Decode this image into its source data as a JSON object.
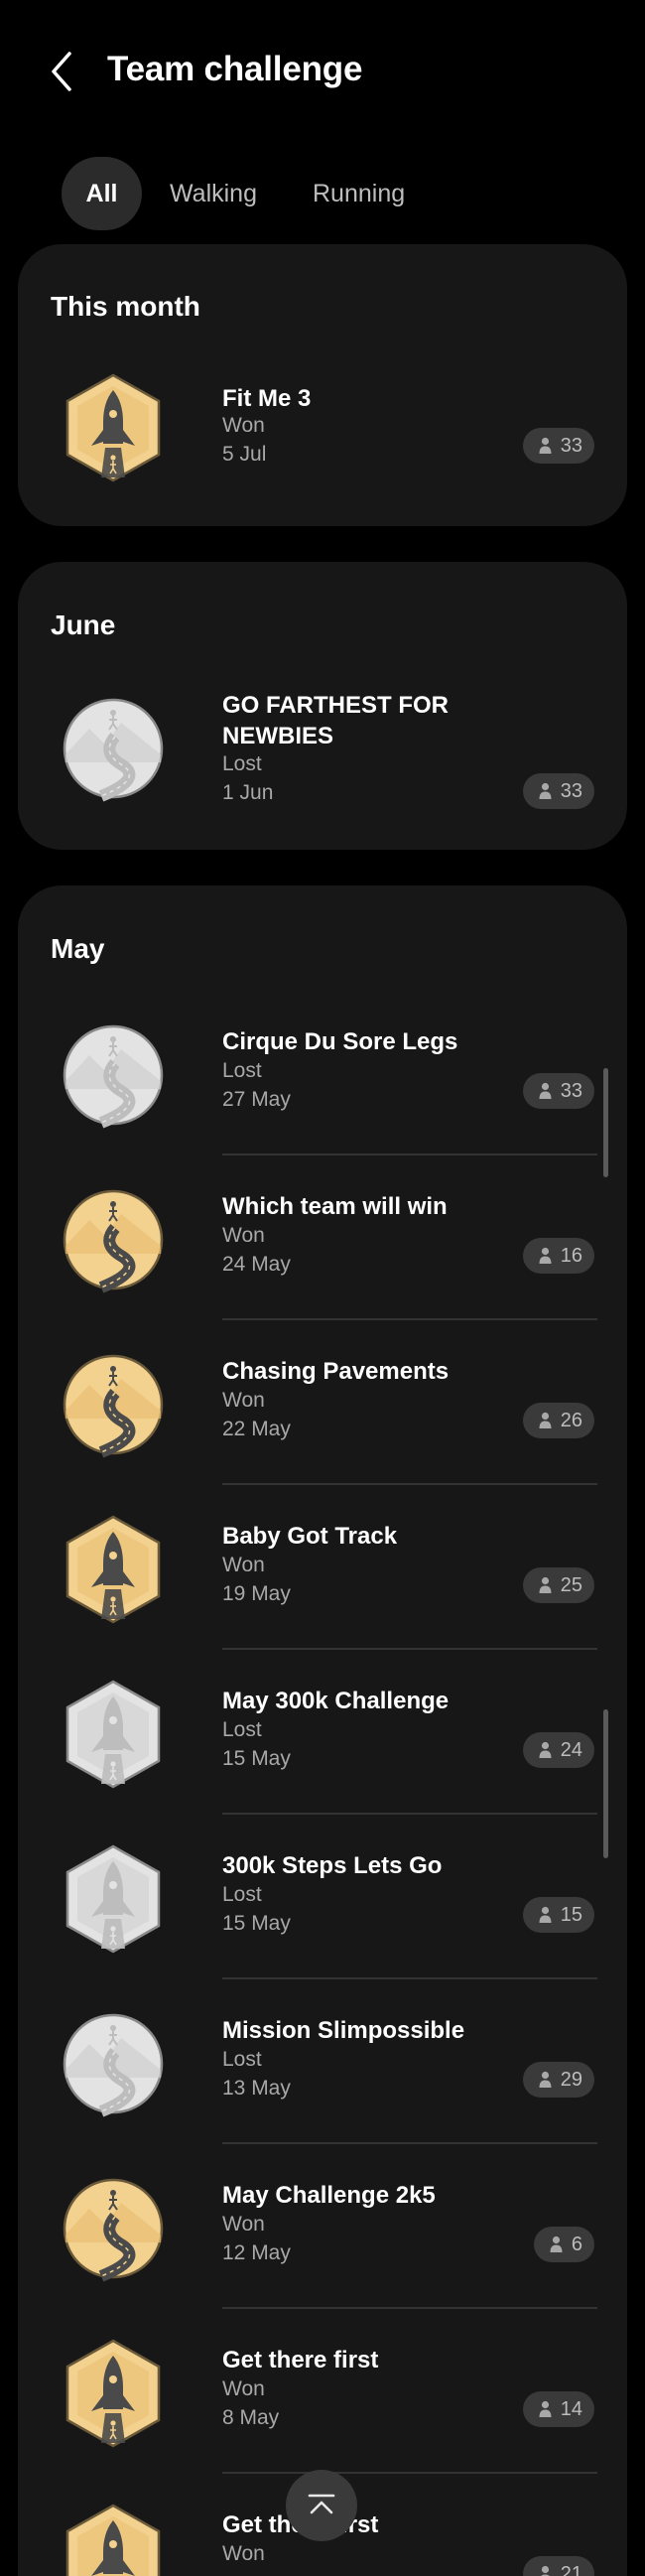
{
  "header": {
    "title": "Team challenge",
    "back_icon": "chevron-left-icon"
  },
  "tabs": [
    {
      "label": "All",
      "selected": true
    },
    {
      "label": "Walking",
      "selected": false
    },
    {
      "label": "Running",
      "selected": false
    }
  ],
  "sections": [
    {
      "title": "This month",
      "items": [
        {
          "name": "Fit Me 3",
          "status": "Won",
          "date": "5 Jul",
          "participants": "33",
          "badge": "rocket-badge-gold"
        }
      ]
    },
    {
      "title": "June",
      "items": [
        {
          "name": "GO FARTHEST FOR NEWBIES",
          "status": "Lost",
          "date": "1 Jun",
          "participants": "33",
          "badge": "road-badge-silver"
        }
      ]
    },
    {
      "title": "May",
      "items": [
        {
          "name": "Cirque Du Sore Legs",
          "status": "Lost",
          "date": "27 May",
          "participants": "33",
          "badge": "road-badge-silver"
        },
        {
          "name": "Which team will win",
          "status": "Won",
          "date": "24 May",
          "participants": "16",
          "badge": "road-badge-gold"
        },
        {
          "name": "Chasing Pavements",
          "status": "Won",
          "date": "22 May",
          "participants": "26",
          "badge": "road-badge-gold"
        },
        {
          "name": "Baby Got Track",
          "status": "Won",
          "date": "19 May",
          "participants": "25",
          "badge": "rocket-badge-gold"
        },
        {
          "name": "May 300k Challenge",
          "status": "Lost",
          "date": "15 May",
          "participants": "24",
          "badge": "rocket-badge-silver"
        },
        {
          "name": "300k Steps Lets Go",
          "status": "Lost",
          "date": "15 May",
          "participants": "15",
          "badge": "rocket-badge-silver"
        },
        {
          "name": "Mission Slimpossible",
          "status": "Lost",
          "date": "13 May",
          "participants": "29",
          "badge": "road-badge-silver"
        },
        {
          "name": "May Challenge 2k5",
          "status": "Won",
          "date": "12 May",
          "participants": "6",
          "badge": "road-badge-gold"
        },
        {
          "name": "Get there first",
          "status": "Won",
          "date": "8 May",
          "participants": "14",
          "badge": "rocket-badge-gold"
        },
        {
          "name": "Get there first",
          "status": "Won",
          "date": "",
          "participants": "21",
          "badge": "rocket-badge-gold"
        }
      ]
    }
  ],
  "scroll_to_top_icon": "scroll-to-top-icon",
  "colors": {
    "background": "#000000",
    "card": "#171717",
    "gold": "#f3d18f",
    "silver": "#e3e3e3",
    "pill": "#3a3a3a"
  }
}
